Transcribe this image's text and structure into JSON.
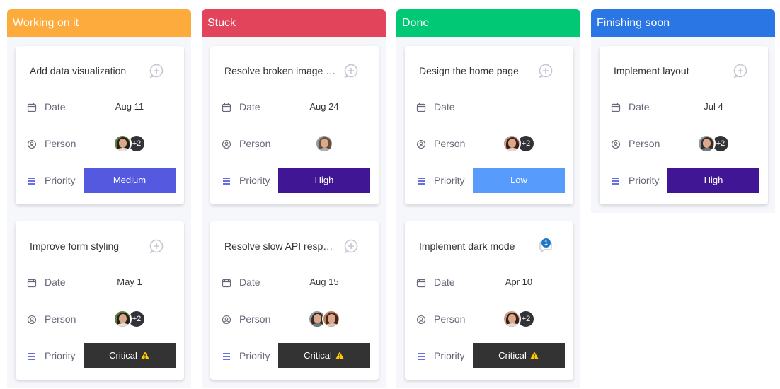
{
  "labels": {
    "date": "Date",
    "person": "Person",
    "priority": "Priority"
  },
  "colors": {
    "working": "#fdab3d",
    "stuck": "#e2445c",
    "done": "#00c875",
    "finishing": "#2b76e5",
    "medium": "#5559df",
    "high": "#401694",
    "low": "#579bfc",
    "critical": "#333333"
  },
  "icons": {
    "add_update": "add-update-icon",
    "date": "calendar-icon",
    "person": "person-icon",
    "priority": "priority-lines-icon",
    "warning": "warning-icon"
  },
  "columns": [
    {
      "title": "Working on it",
      "color": "#fdab3d",
      "cards": [
        {
          "title": "Add data visualization",
          "date": "Aug 11",
          "extra": "+2",
          "priority": "Medium",
          "priority_color": "#5559df"
        },
        {
          "title": "Improve form styling",
          "date": "May 1",
          "extra": "+2",
          "priority": "Critical",
          "priority_color": "#333333",
          "warning": true
        }
      ]
    },
    {
      "title": "Stuck",
      "color": "#e2445c",
      "cards": [
        {
          "title": "Resolve broken image links",
          "date": "Aug 24",
          "priority": "High",
          "priority_color": "#401694"
        },
        {
          "title": "Resolve slow API response",
          "date": "Aug 15",
          "priority": "Critical",
          "priority_color": "#333333",
          "warning": true
        }
      ]
    },
    {
      "title": "Done",
      "color": "#00c875",
      "cards": [
        {
          "title": "Design the home page",
          "date": "",
          "extra": "+2",
          "priority": "Low",
          "priority_color": "#579bfc"
        },
        {
          "title": "Implement dark mode",
          "date": "Apr 10",
          "extra": "+2",
          "priority": "Critical",
          "priority_color": "#333333",
          "warning": true,
          "updates": "1"
        }
      ]
    },
    {
      "title": "Finishing soon",
      "color": "#2b76e5",
      "cards": [
        {
          "title": "Implement layout",
          "date": "Jul 4",
          "extra": "+2",
          "priority": "High",
          "priority_color": "#401694"
        }
      ]
    }
  ]
}
